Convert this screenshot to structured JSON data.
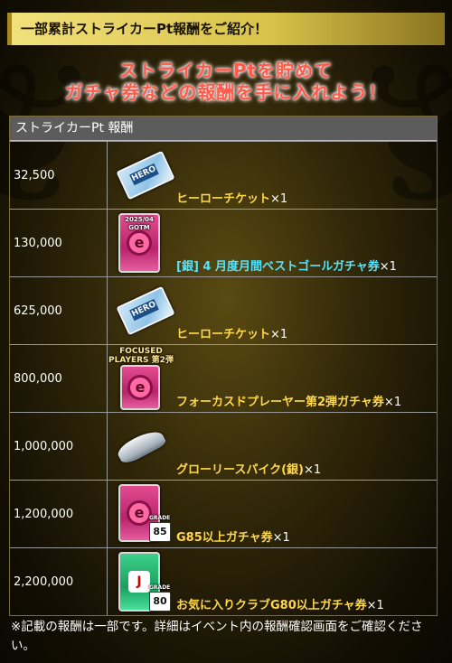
{
  "banner": {
    "text": "一部累計ストライカーPt報酬をご紹介！"
  },
  "headline": {
    "line1": "ストライカーPtを貯めて",
    "line2": "ガチャ券などの報酬を手に入れよう！"
  },
  "table": {
    "header": "ストライカーPt 報酬",
    "rows": [
      {
        "pt": "32,500",
        "item": "ヒーローチケット",
        "count": "×1",
        "icon": "hero-ticket-icon"
      },
      {
        "pt": "130,000",
        "item": "[銀] 4 月度月間ベストゴールガチャ券",
        "count": "×1",
        "icon": "gacha-ticket-icon",
        "badge": "2025/04 GOTM",
        "color": "#54e4ff"
      },
      {
        "pt": "625,000",
        "item": "ヒーローチケット",
        "count": "×1",
        "icon": "hero-ticket-icon"
      },
      {
        "pt": "800,000",
        "item": "フォーカスドプレーヤー第2弾ガチャ券",
        "count": "×1",
        "icon": "gacha-ticket-icon",
        "badge": "FOCUSED PLAYERS 第2弾"
      },
      {
        "pt": "1,000,000",
        "item": "グローリースパイク(銀)",
        "count": "×1",
        "icon": "spike-shoe-icon"
      },
      {
        "pt": "1,200,000",
        "item": "G85以上ガチャ券",
        "count": "×1",
        "icon": "gacha-ticket-icon",
        "grade": "85"
      },
      {
        "pt": "2,200,000",
        "item": "お気に入りクラブG80以上ガチャ券",
        "count": "×1",
        "icon": "club-gacha-ticket-icon",
        "grade": "80"
      }
    ],
    "ticket_label": "HERO",
    "grade_label": "GRADE"
  },
  "note": "※記載の報酬は一部です。詳細はイベント内の報酬確認画面をご確認ください。",
  "colors": {
    "reward_yellow": "#ffd84a",
    "reward_cyan": "#54e4ff",
    "headline_red": "#ff5a4a"
  }
}
